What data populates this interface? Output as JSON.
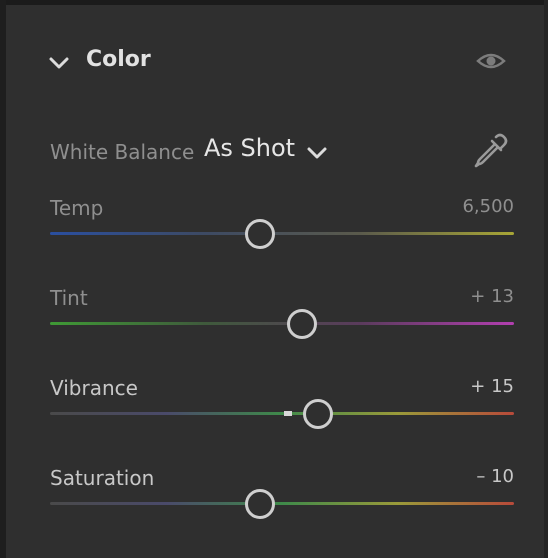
{
  "section": {
    "title": "Color",
    "collapse_icon": "chevron-down-icon",
    "visibility_icon": "eye-icon"
  },
  "white_balance": {
    "label": "White Balance",
    "value": "As Shot",
    "picker_icon": "eyedropper-icon"
  },
  "sliders": [
    {
      "label": "Temp",
      "value": "6,500",
      "position": 0.45,
      "gradient": [
        "#2a4fa0",
        "#3d4a63",
        "#5a5a4c",
        "#a8a636"
      ]
    },
    {
      "label": "Tint",
      "value": "+ 13",
      "position": 0.54,
      "gradient": [
        "#3f9a35",
        "#3f5a3c",
        "#5a3b5c",
        "#b23fb0"
      ]
    },
    {
      "label": "Vibrance",
      "value": "+ 15",
      "position": 0.575,
      "gradient": [
        "#4a4a4a",
        "#4a4a6a",
        "#3f8a4a",
        "#9a9a3a",
        "#b84a3a"
      ]
    },
    {
      "label": "Saturation",
      "value": "– 10",
      "position": 0.45,
      "gradient": [
        "#4a4a4a",
        "#4a4a6a",
        "#3f8a4a",
        "#9a9a3a",
        "#b84a3a"
      ]
    }
  ]
}
